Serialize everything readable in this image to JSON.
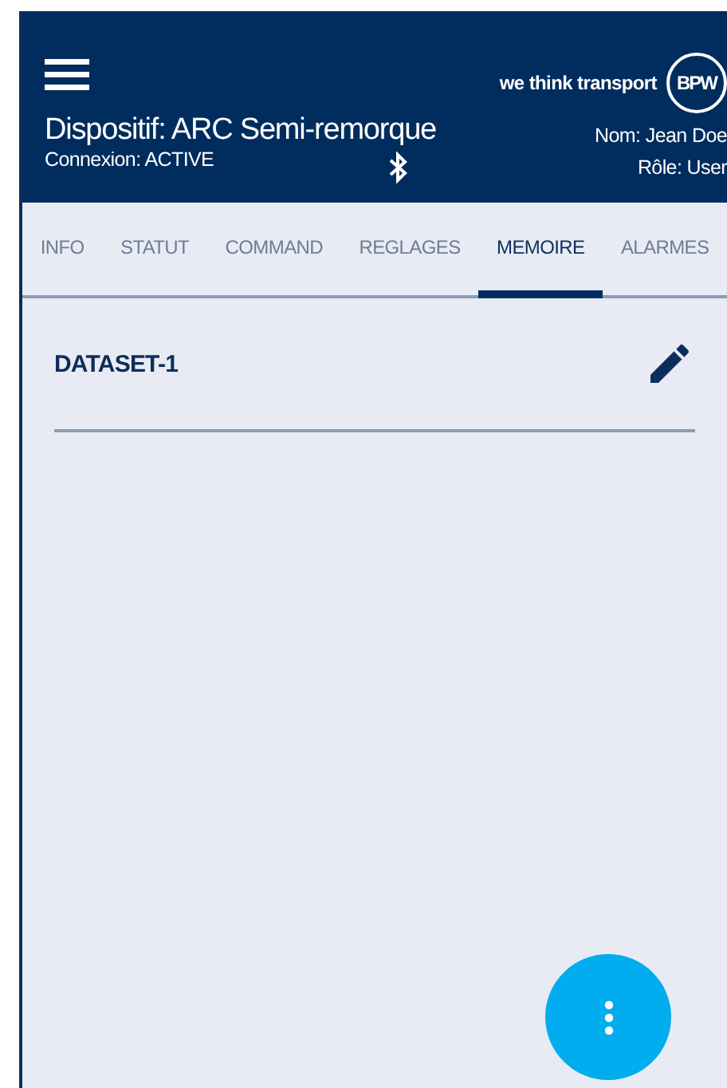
{
  "header": {
    "slogan": "we think transport",
    "logo_text": "BPW",
    "device": "Dispositif: ARC Semi-remorque",
    "connection": "Connexion: ACTIVE",
    "name": "Nom: Jean Doe",
    "role": "Rôle: User"
  },
  "tabs": [
    {
      "label": "INFO",
      "selected": false
    },
    {
      "label": "STATUT",
      "selected": false
    },
    {
      "label": "COMMAND",
      "selected": false
    },
    {
      "label": "REGLAGES",
      "selected": false
    },
    {
      "label": "MEMOIRE",
      "selected": true
    },
    {
      "label": "ALARMES",
      "selected": false
    }
  ],
  "datasets": [
    {
      "name": "DATASET-1"
    }
  ]
}
